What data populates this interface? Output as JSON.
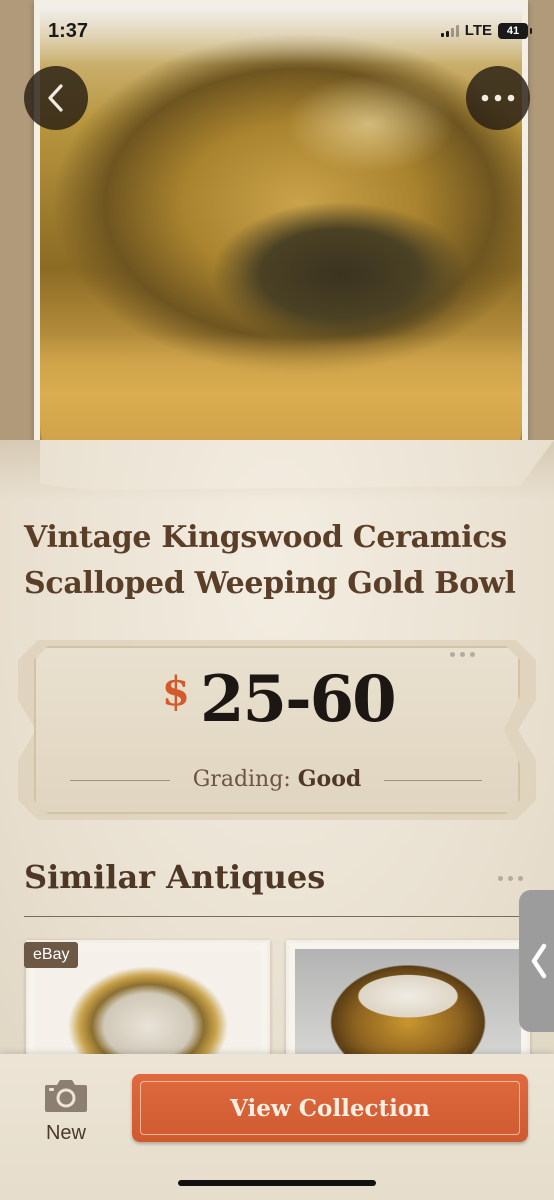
{
  "status_bar": {
    "time": "1:37",
    "network": "LTE",
    "battery": "41"
  },
  "hero": {
    "back_icon": "chevron-left-icon",
    "more_icon": "ellipsis-icon"
  },
  "item": {
    "title_line1": "Vintage Kingswood Ceramics",
    "title_line2": "Scalloped Weeping Gold Bowl",
    "price_symbol": "$",
    "price_range": "25-60",
    "grading_label": "Grading:",
    "grading_value": "Good"
  },
  "similar": {
    "title": "Similar Antiques",
    "cards": [
      {
        "badge": "eBay"
      },
      {
        "badge": ""
      }
    ]
  },
  "bottom_bar": {
    "new_label": "New",
    "view_collection_label": "View Collection"
  },
  "colors": {
    "accent": "#d45a2c",
    "title_brown": "#5a3e28",
    "parchment": "#e9e1d3"
  }
}
